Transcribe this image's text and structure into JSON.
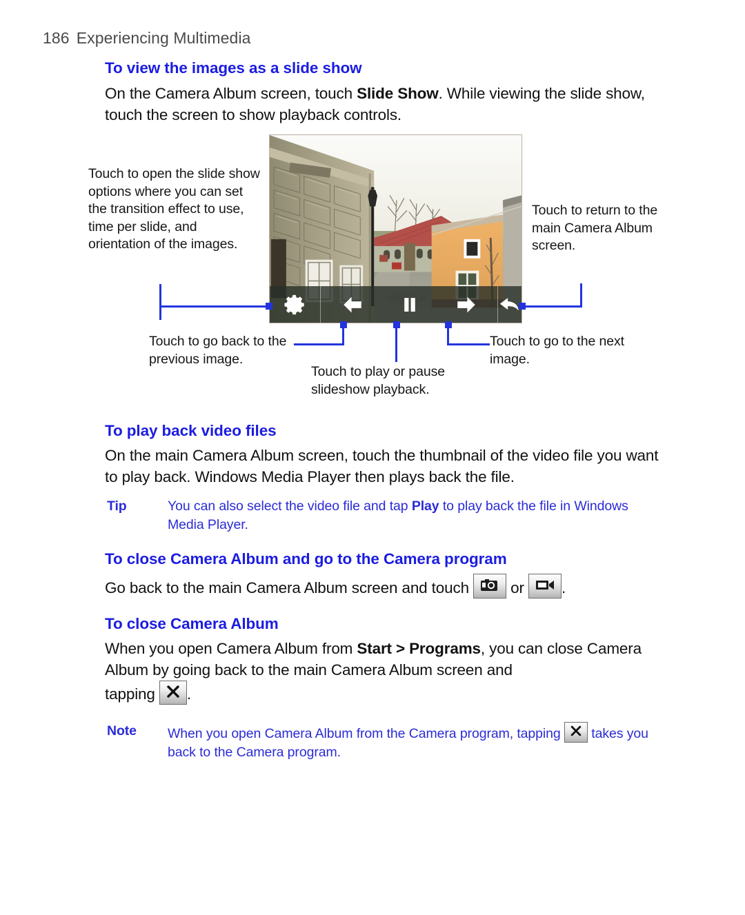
{
  "page": {
    "number": "186",
    "running_title": "Experiencing Multimedia"
  },
  "colors": {
    "heading_blue": "#1b1ce0",
    "note_blue": "#2b2bd6",
    "leader_line_blue": "#2334dd",
    "body_black": "#111111",
    "header_gray": "#4a4a4a"
  },
  "sections": {
    "slideshow": {
      "heading": "To view the images as a slide show",
      "body_line1_a": "On the Camera Album screen, touch ",
      "body_line1_b": "Slide Show",
      "body_line1_c": ". While viewing the slide",
      "body_line2": "show, touch the screen to show playback controls."
    },
    "video": {
      "heading": "To play back video files",
      "body_line1": "On the main Camera Album screen, touch the thumbnail of the video file",
      "body_line2": "you want to play back. Windows Media Player then plays back the file.",
      "tip": {
        "label": "Tip",
        "text_a": "You can also select the video file and tap ",
        "text_b": "Play",
        "text_c": " to play back the file in",
        "text_line2": "Windows Media Player."
      }
    },
    "close_and_camera": {
      "heading": "To close Camera Album and go to the Camera program",
      "body_a": "Go back to the main Camera Album screen and touch ",
      "body_b": " or ",
      "body_c": "."
    },
    "close_album": {
      "heading": "To close Camera Album",
      "body_line1_a": "When you open Camera Album from ",
      "body_line1_b": "Start > Programs",
      "body_line1_c": ", you can close",
      "body_line2": "Camera Album by going back to the main Camera Album screen and",
      "body_line3_a": "tapping ",
      "body_line3_b": ".",
      "note": {
        "label": "Note",
        "text_a": "When you open Camera Album from the Camera program, tapping ",
        "text_line2": "takes you back to the Camera program."
      }
    }
  },
  "callouts": {
    "settings": "Touch to open the slide show options where you can set the transition effect to use, time per slide, and orientation of the images.",
    "back": "Touch to return to the main Camera Album screen.",
    "previous": "Touch to go back to the previous image.",
    "play_pause": "Touch to play or pause slideshow playback.",
    "next": "Touch to go to the next image."
  },
  "screenshot": {
    "alt": "Slide show of a European cobblestone street with stone building, red-roofed house and orange house",
    "controls": [
      {
        "name": "settings",
        "icon": "gear-icon"
      },
      {
        "name": "previous",
        "icon": "arrow-left-icon"
      },
      {
        "name": "play-pause",
        "icon": "pause-icon"
      },
      {
        "name": "next",
        "icon": "arrow-right-icon"
      },
      {
        "name": "back",
        "icon": "back-arrow-icon"
      }
    ]
  },
  "inline_icons": {
    "camera": "camera-icon",
    "camcorder": "camcorder-icon",
    "close": "close-x-icon"
  }
}
